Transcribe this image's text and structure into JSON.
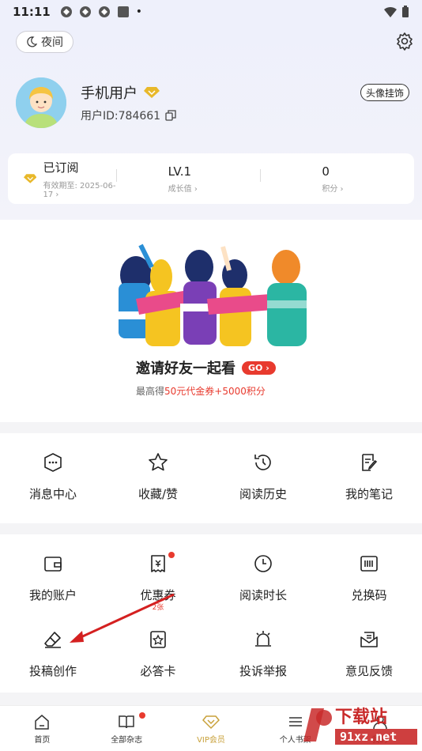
{
  "status_bar": {
    "time": "11:11"
  },
  "header": {
    "night_label": "夜间",
    "user_name": "手机用户",
    "user_id": "用户ID:784661",
    "pendant_label": "头像挂饰"
  },
  "stats": {
    "subscribed": {
      "value": "已订阅",
      "sub": "有效期至: 2025-06-17 ›"
    },
    "level": {
      "value": "LV.1",
      "sub": "成长值 ›"
    },
    "points": {
      "value": "0",
      "sub": "积分 ›"
    }
  },
  "invite": {
    "title": "邀请好友一起看",
    "go_label": "GO ›",
    "sub_prefix": "最高得",
    "sub_highlight": "50元代金券+5000积分"
  },
  "menu_row1": [
    {
      "label": "消息中心",
      "icon": "message-icon"
    },
    {
      "label": "收藏/赞",
      "icon": "star-icon"
    },
    {
      "label": "阅读历史",
      "icon": "history-icon"
    },
    {
      "label": "我的笔记",
      "icon": "note-icon"
    }
  ],
  "menu_row2": [
    {
      "label": "我的账户",
      "icon": "wallet-icon"
    },
    {
      "label": "优惠券",
      "icon": "coupon-icon",
      "sub": "2张"
    },
    {
      "label": "阅读时长",
      "icon": "clock-icon"
    },
    {
      "label": "兑换码",
      "icon": "barcode-icon"
    }
  ],
  "menu_row3": [
    {
      "label": "投稿创作",
      "icon": "eraser-icon"
    },
    {
      "label": "必答卡",
      "icon": "card-icon"
    },
    {
      "label": "投诉举报",
      "icon": "alarm-icon"
    },
    {
      "label": "意见反馈",
      "icon": "feedback-icon"
    }
  ],
  "tabs": [
    {
      "label": "首页",
      "icon": "home-icon"
    },
    {
      "label": "全部杂志",
      "icon": "book-icon"
    },
    {
      "label": "VIP会员",
      "icon": "diamond-icon"
    },
    {
      "label": "个人书架",
      "icon": "shelf-icon"
    },
    {
      "label": "我的",
      "icon": "user-icon"
    }
  ],
  "watermark": {
    "text1": "下载站",
    "text2": "91xz.net"
  },
  "colors": {
    "accent": "#e83a2e",
    "gold": "#e8b82a",
    "vip": "#c8a13a"
  }
}
